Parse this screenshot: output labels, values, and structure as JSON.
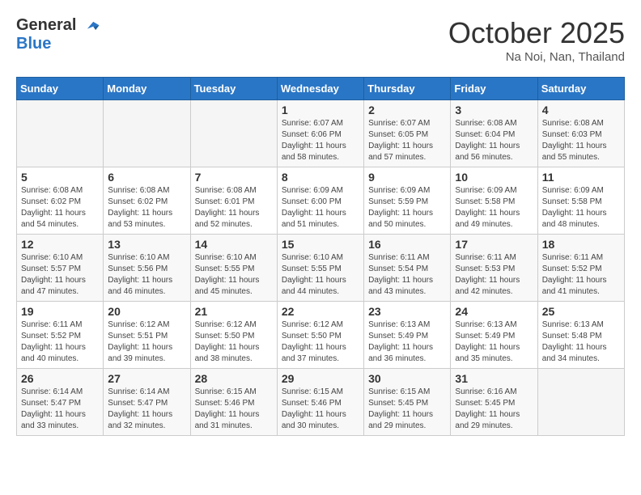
{
  "logo": {
    "line1": "General",
    "line2": "Blue"
  },
  "header": {
    "month": "October 2025",
    "location": "Na Noi, Nan, Thailand"
  },
  "weekdays": [
    "Sunday",
    "Monday",
    "Tuesday",
    "Wednesday",
    "Thursday",
    "Friday",
    "Saturday"
  ],
  "weeks": [
    [
      {
        "day": "",
        "info": ""
      },
      {
        "day": "",
        "info": ""
      },
      {
        "day": "",
        "info": ""
      },
      {
        "day": "1",
        "info": "Sunrise: 6:07 AM\nSunset: 6:06 PM\nDaylight: 11 hours\nand 58 minutes."
      },
      {
        "day": "2",
        "info": "Sunrise: 6:07 AM\nSunset: 6:05 PM\nDaylight: 11 hours\nand 57 minutes."
      },
      {
        "day": "3",
        "info": "Sunrise: 6:08 AM\nSunset: 6:04 PM\nDaylight: 11 hours\nand 56 minutes."
      },
      {
        "day": "4",
        "info": "Sunrise: 6:08 AM\nSunset: 6:03 PM\nDaylight: 11 hours\nand 55 minutes."
      }
    ],
    [
      {
        "day": "5",
        "info": "Sunrise: 6:08 AM\nSunset: 6:02 PM\nDaylight: 11 hours\nand 54 minutes."
      },
      {
        "day": "6",
        "info": "Sunrise: 6:08 AM\nSunset: 6:02 PM\nDaylight: 11 hours\nand 53 minutes."
      },
      {
        "day": "7",
        "info": "Sunrise: 6:08 AM\nSunset: 6:01 PM\nDaylight: 11 hours\nand 52 minutes."
      },
      {
        "day": "8",
        "info": "Sunrise: 6:09 AM\nSunset: 6:00 PM\nDaylight: 11 hours\nand 51 minutes."
      },
      {
        "day": "9",
        "info": "Sunrise: 6:09 AM\nSunset: 5:59 PM\nDaylight: 11 hours\nand 50 minutes."
      },
      {
        "day": "10",
        "info": "Sunrise: 6:09 AM\nSunset: 5:58 PM\nDaylight: 11 hours\nand 49 minutes."
      },
      {
        "day": "11",
        "info": "Sunrise: 6:09 AM\nSunset: 5:58 PM\nDaylight: 11 hours\nand 48 minutes."
      }
    ],
    [
      {
        "day": "12",
        "info": "Sunrise: 6:10 AM\nSunset: 5:57 PM\nDaylight: 11 hours\nand 47 minutes."
      },
      {
        "day": "13",
        "info": "Sunrise: 6:10 AM\nSunset: 5:56 PM\nDaylight: 11 hours\nand 46 minutes."
      },
      {
        "day": "14",
        "info": "Sunrise: 6:10 AM\nSunset: 5:55 PM\nDaylight: 11 hours\nand 45 minutes."
      },
      {
        "day": "15",
        "info": "Sunrise: 6:10 AM\nSunset: 5:55 PM\nDaylight: 11 hours\nand 44 minutes."
      },
      {
        "day": "16",
        "info": "Sunrise: 6:11 AM\nSunset: 5:54 PM\nDaylight: 11 hours\nand 43 minutes."
      },
      {
        "day": "17",
        "info": "Sunrise: 6:11 AM\nSunset: 5:53 PM\nDaylight: 11 hours\nand 42 minutes."
      },
      {
        "day": "18",
        "info": "Sunrise: 6:11 AM\nSunset: 5:52 PM\nDaylight: 11 hours\nand 41 minutes."
      }
    ],
    [
      {
        "day": "19",
        "info": "Sunrise: 6:11 AM\nSunset: 5:52 PM\nDaylight: 11 hours\nand 40 minutes."
      },
      {
        "day": "20",
        "info": "Sunrise: 6:12 AM\nSunset: 5:51 PM\nDaylight: 11 hours\nand 39 minutes."
      },
      {
        "day": "21",
        "info": "Sunrise: 6:12 AM\nSunset: 5:50 PM\nDaylight: 11 hours\nand 38 minutes."
      },
      {
        "day": "22",
        "info": "Sunrise: 6:12 AM\nSunset: 5:50 PM\nDaylight: 11 hours\nand 37 minutes."
      },
      {
        "day": "23",
        "info": "Sunrise: 6:13 AM\nSunset: 5:49 PM\nDaylight: 11 hours\nand 36 minutes."
      },
      {
        "day": "24",
        "info": "Sunrise: 6:13 AM\nSunset: 5:49 PM\nDaylight: 11 hours\nand 35 minutes."
      },
      {
        "day": "25",
        "info": "Sunrise: 6:13 AM\nSunset: 5:48 PM\nDaylight: 11 hours\nand 34 minutes."
      }
    ],
    [
      {
        "day": "26",
        "info": "Sunrise: 6:14 AM\nSunset: 5:47 PM\nDaylight: 11 hours\nand 33 minutes."
      },
      {
        "day": "27",
        "info": "Sunrise: 6:14 AM\nSunset: 5:47 PM\nDaylight: 11 hours\nand 32 minutes."
      },
      {
        "day": "28",
        "info": "Sunrise: 6:15 AM\nSunset: 5:46 PM\nDaylight: 11 hours\nand 31 minutes."
      },
      {
        "day": "29",
        "info": "Sunrise: 6:15 AM\nSunset: 5:46 PM\nDaylight: 11 hours\nand 30 minutes."
      },
      {
        "day": "30",
        "info": "Sunrise: 6:15 AM\nSunset: 5:45 PM\nDaylight: 11 hours\nand 29 minutes."
      },
      {
        "day": "31",
        "info": "Sunrise: 6:16 AM\nSunset: 5:45 PM\nDaylight: 11 hours\nand 29 minutes."
      },
      {
        "day": "",
        "info": ""
      }
    ]
  ]
}
